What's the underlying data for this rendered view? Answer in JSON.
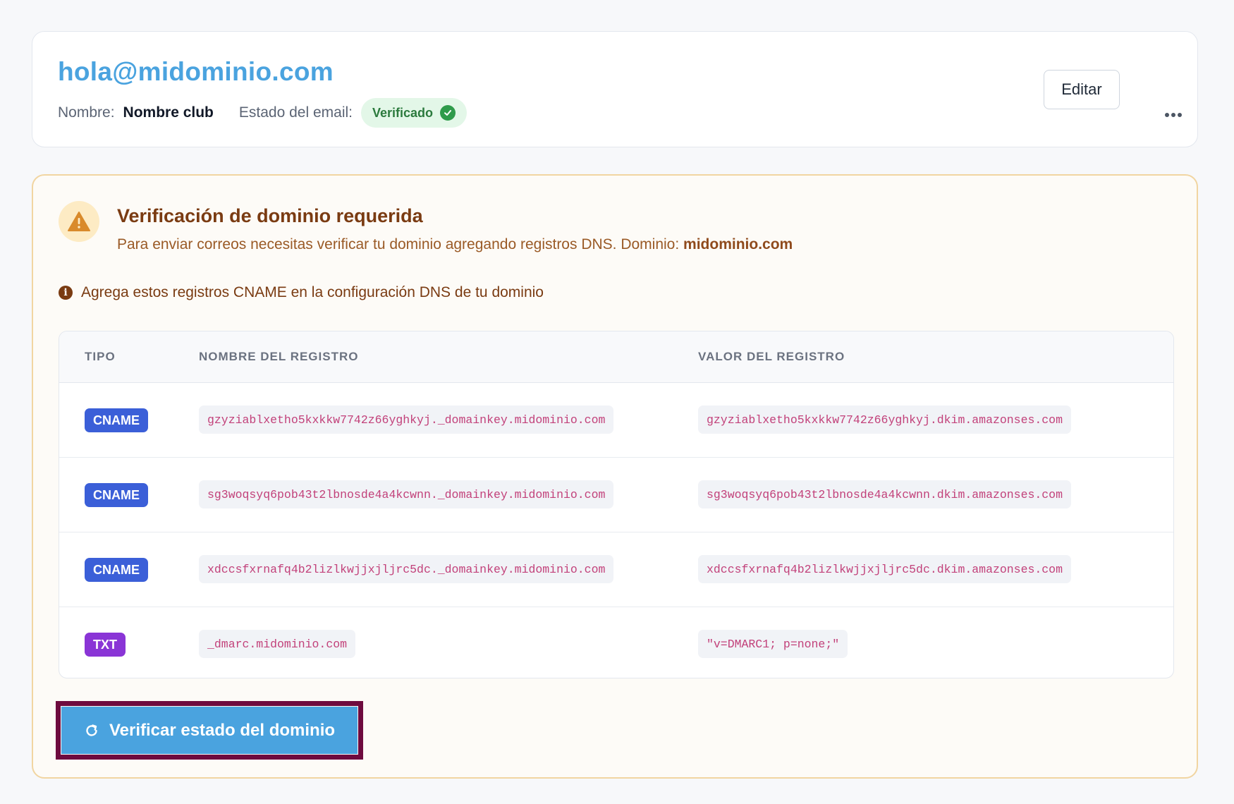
{
  "email_card": {
    "email": "hola@midominio.com",
    "name_label": "Nombre:",
    "name_value": "Nombre club",
    "status_label": "Estado del email:",
    "status_badge": "Verificado",
    "edit_button": "Editar",
    "more_icon": "more-horizontal-icon"
  },
  "verification": {
    "title": "Verificación de dominio requerida",
    "description": "Para enviar correos necesitas verificar tu dominio agregando registros DNS. Dominio:",
    "domain": "midominio.com",
    "info": "Agrega estos registros CNAME en la configuración DNS de tu dominio",
    "table": {
      "headers": {
        "type": "TIPO",
        "name": "NOMBRE DEL REGISTRO",
        "value": "VALOR DEL REGISTRO"
      },
      "rows": [
        {
          "type": "CNAME",
          "name": "gzyziablxetho5kxkkw7742z66yghkyj._domainkey.midominio.com",
          "value": "gzyziablxetho5kxkkw7742z66yghkyj.dkim.amazonses.com"
        },
        {
          "type": "CNAME",
          "name": "sg3woqsyq6pob43t2lbnosde4a4kcwnn._domainkey.midominio.com",
          "value": "sg3woqsyq6pob43t2lbnosde4a4kcwnn.dkim.amazonses.com"
        },
        {
          "type": "CNAME",
          "name": "xdccsfxrnafq4b2lizlkwjjxjljrc5dc._domainkey.midominio.com",
          "value": "xdccsfxrnafq4b2lizlkwjjxjljrc5dc.dkim.amazonses.com"
        },
        {
          "type": "TXT",
          "name": "_dmarc.midominio.com",
          "value": "\"v=DMARC1; p=none;\""
        }
      ]
    },
    "verify_button": "Verificar estado del dominio"
  },
  "colors": {
    "accent": "#4aa3df",
    "cname_badge": "#3b5fd8",
    "txt_badge": "#8a35d6",
    "verified_green": "#2f9b4b",
    "warning_brown": "#7a3b12"
  }
}
